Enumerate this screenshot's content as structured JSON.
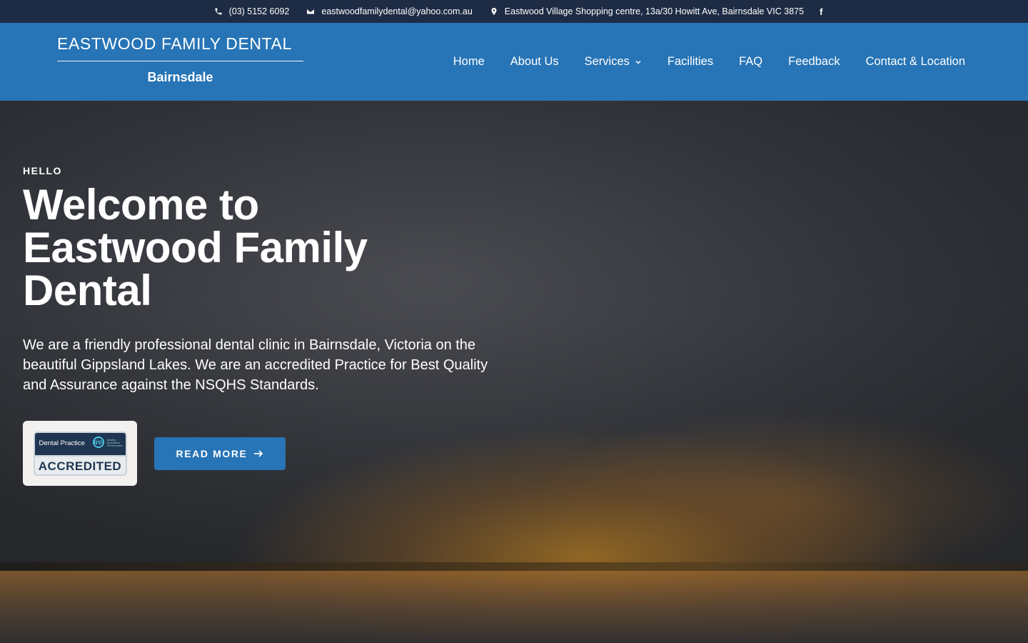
{
  "topbar": {
    "phone": "(03) 5152 6092",
    "email": "eastwoodfamilydental@yahoo.com.au",
    "address": "Eastwood Village Shopping centre, 13a/30 Howitt Ave, Bairnsdale VIC 3875",
    "facebook_glyph": "f"
  },
  "header": {
    "logo_title": "EASTWOOD FAMILY DENTAL",
    "logo_sub": "Bairnsdale",
    "nav": {
      "home": "Home",
      "about": "About Us",
      "services": "Services",
      "facilities": "Facilities",
      "faq": "FAQ",
      "feedback": "Feedback",
      "contact": "Contact & Location"
    }
  },
  "hero": {
    "eyebrow": "HELLO",
    "headline": "Welcome to Eastwood Family Dental",
    "lead": "We are a friendly professional dental clinic in Bairnsdale, Victoria on the beautiful Gippsland Lakes. We are an accredited Practice for Best Quality and Assurance against the NSQHS Standards.",
    "badge": {
      "top": "Dental Practice",
      "logo": "qip",
      "logo_text": "Quality Innovation Performance",
      "bottom": "ACCREDITED"
    },
    "cta_label": "READ MORE"
  },
  "colors": {
    "topbar_bg": "#1d2b44",
    "header_bg": "#2774b6",
    "button_bg": "#2774b6"
  },
  "icons": [
    "phone-icon",
    "mail-icon",
    "map-pin-icon",
    "facebook-icon",
    "chevron-down-icon",
    "arrow-right-icon"
  ]
}
